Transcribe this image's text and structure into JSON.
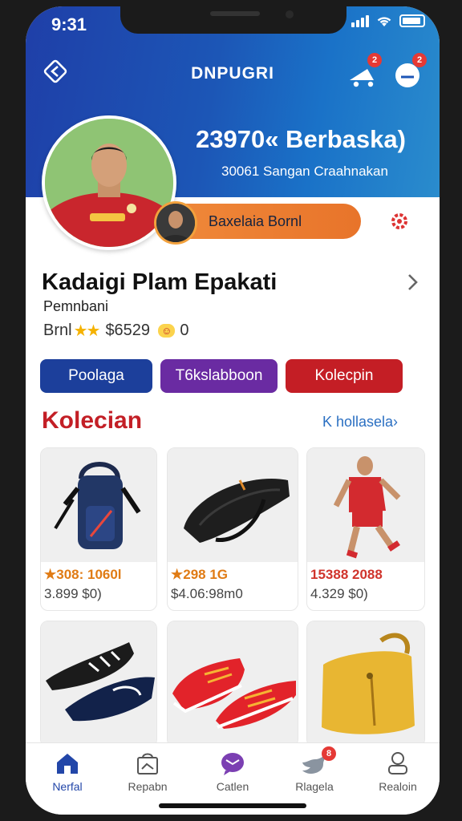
{
  "status_bar": {
    "time": "9:31"
  },
  "header": {
    "title": "DNPUGRI",
    "cart_badge": "2",
    "chat_badge": "2"
  },
  "hero": {
    "big_text": "23970« Berbaska)",
    "sub_text": "30061  Sangan Craahnakan"
  },
  "profile_action": {
    "label": "Baxelaia Bornl"
  },
  "profile": {
    "name": "Kadaigi Plam Epakati",
    "role": "Pemnbani",
    "stat_label": "Brnl",
    "stars": "★★",
    "stat_value": "$6529",
    "badge": "☺",
    "count": "0"
  },
  "tab_buttons": [
    {
      "label": "Poolaga",
      "color": "#1c3f9b"
    },
    {
      "label": "T6kslabboon",
      "color": "#6a2ba2"
    },
    {
      "label": "Kolecpin",
      "color": "#c41e25"
    }
  ],
  "section": {
    "title": "Kolecian",
    "link": "K hollasela›"
  },
  "products": [
    {
      "name": "backpack",
      "price1": "★308: 1060l",
      "price2": "3.899 $0)",
      "price1_color": "#e07b14"
    },
    {
      "name": "sling-bag",
      "price1": "★298 1G",
      "price2": "$4.06:98m0",
      "price1_color": "#e07b14"
    },
    {
      "name": "player-figure",
      "price1": "15388 2088",
      "price2": "4.329 $0)",
      "price1_color": "#d0342c"
    },
    {
      "name": "cleats",
      "price1": "",
      "price2": ""
    },
    {
      "name": "red-sneakers",
      "price1": "",
      "price2": ""
    },
    {
      "name": "yellow-bag",
      "price1": "",
      "price2": ""
    }
  ],
  "bottom_nav": [
    {
      "label": "Nerfal",
      "icon": "home-icon"
    },
    {
      "label": "Repabn",
      "icon": "shop-icon"
    },
    {
      "label": "Catlen",
      "icon": "chat-icon"
    },
    {
      "label": "Rlagela",
      "icon": "bird-icon",
      "badge": "8"
    },
    {
      "label": "Realoin",
      "icon": "profile-icon"
    }
  ],
  "colors": {
    "primary": "#1f3fa8",
    "accent_orange": "#ec7d33",
    "accent_red": "#c31f26",
    "link_blue": "#2a6fc2"
  }
}
